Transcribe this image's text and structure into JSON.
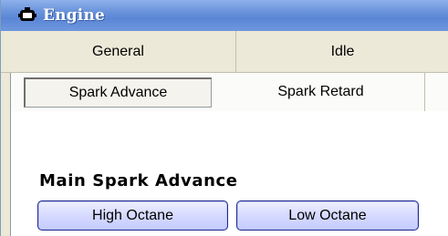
{
  "window": {
    "title": "Engine",
    "title_icon": "engine-icon"
  },
  "top_tabs": [
    {
      "label": "General"
    },
    {
      "label": "Idle"
    }
  ],
  "sub_tabs": [
    {
      "label": "Spark Advance",
      "selected": true
    },
    {
      "label": "Spark Retard",
      "selected": false
    }
  ],
  "section": {
    "title": "Main Spark Advance"
  },
  "buttons": [
    {
      "label": "High Octane"
    },
    {
      "label": "Low Octane"
    }
  ],
  "colors": {
    "titlebar": "#6c95dc",
    "button_fill": "#d8dcff",
    "button_border": "#1f2b8a"
  }
}
